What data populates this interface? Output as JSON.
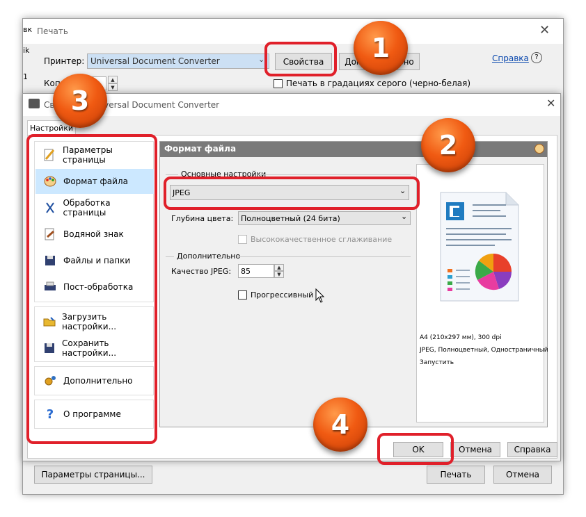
{
  "print_dialog": {
    "title": "Печать",
    "printer_label": "Принтер:",
    "printer_value": "Universal Document Converter",
    "properties_button": "Свойства",
    "additional_button": "Дополнительно",
    "help_link": "Справка",
    "copies_label": "Копии",
    "grayscale_label": "Печать в градациях серого (черно-белая)",
    "page_setup_button": "Параметры страницы...",
    "print_button": "Печать",
    "cancel_button": "Отмена",
    "left_fragments": [
      "вк",
      "ik",
      "1"
    ]
  },
  "props_dialog": {
    "title": "Свойства: Universal Document Converter",
    "tab": "Настройки",
    "nav_group1": [
      {
        "label": "Параметры страницы",
        "icon": "page-params-icon"
      },
      {
        "label": "Формат файла",
        "icon": "palette-icon",
        "selected": true
      },
      {
        "label": "Обработка страницы",
        "icon": "scissors-icon"
      },
      {
        "label": "Водяной знак",
        "icon": "watermark-icon"
      },
      {
        "label": "Файлы и папки",
        "icon": "floppy-icon"
      },
      {
        "label": "Пост-обработка",
        "icon": "printer-icon"
      }
    ],
    "nav_group2": [
      {
        "label": "Загрузить настройки...",
        "icon": "load-folder-icon"
      },
      {
        "label": "Сохранить настройки...",
        "icon": "save-floppy-icon"
      }
    ],
    "nav_additional": "Дополнительно",
    "nav_about": "О программе",
    "panel_title": "Формат файла",
    "basic_group": "Основные настройки",
    "format_value": "JPEG",
    "color_depth_label": "Глубина цвета:",
    "color_depth_value": "Полноцветный (24 бита)",
    "smoothing_label": "Высококачественное сглаживание",
    "additional_group": "Дополнительно",
    "quality_label": "Качество JPEG:",
    "quality_value": "85",
    "progressive_label": "Прогрессивный",
    "preview_line1": "A4 (210x297 мм), 300 dpi",
    "preview_line2": "JPEG, Полноцветный, Одностраничный",
    "preview_line3": "Запустить",
    "ok_button": "OK",
    "cancel_button": "Отмена",
    "help_button": "Справка"
  },
  "markers": [
    "1",
    "2",
    "3",
    "4"
  ],
  "colors": {
    "accent_red": "#e0202a",
    "marker_orange": "#f05a12",
    "panel_header": "#7a7a7a",
    "selected": "#cce8ff"
  }
}
